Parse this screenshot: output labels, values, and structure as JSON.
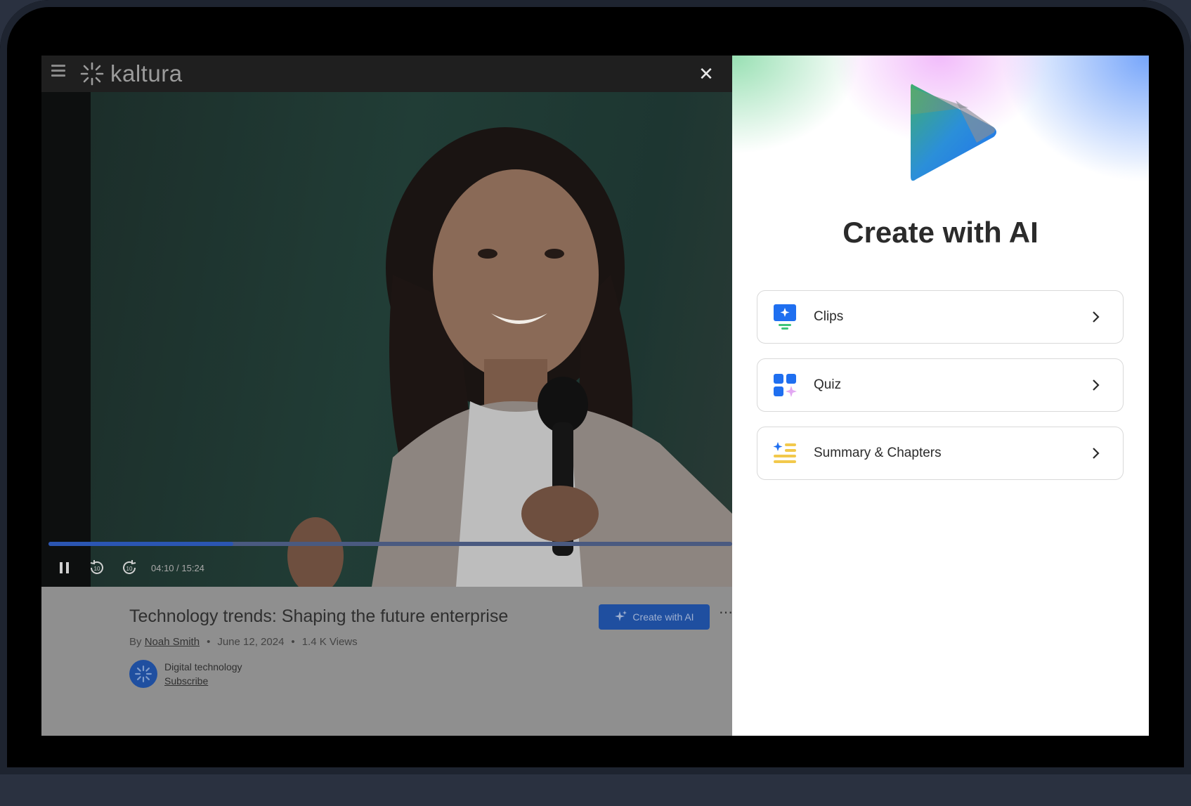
{
  "app": {
    "logo_text": "kaltura",
    "close_symbol": "✕"
  },
  "player": {
    "time": "04:10 / 15:24",
    "progress_fraction": 0.27
  },
  "video_info": {
    "title": "Technology trends: Shaping the future enterprise",
    "by": "By",
    "author": "Noah Smith",
    "date": "June 12, 2024",
    "views": "1.4 K Views",
    "create_ai_label": "Create with AI",
    "more_symbol": "⋯",
    "channel_name": "Digital technology",
    "subscribe": "Subscribe"
  },
  "ai_panel": {
    "title": "Create with AI",
    "options": [
      {
        "label": "Clips",
        "icon": "clips-icon"
      },
      {
        "label": "Quiz",
        "icon": "quiz-icon"
      },
      {
        "label": "Summary & Chapters",
        "icon": "summary-icon"
      }
    ]
  },
  "colors": {
    "accent_blue": "#1f6ff0",
    "button_blue": "#1f4fa0",
    "progress_blue": "#2b56b2"
  }
}
